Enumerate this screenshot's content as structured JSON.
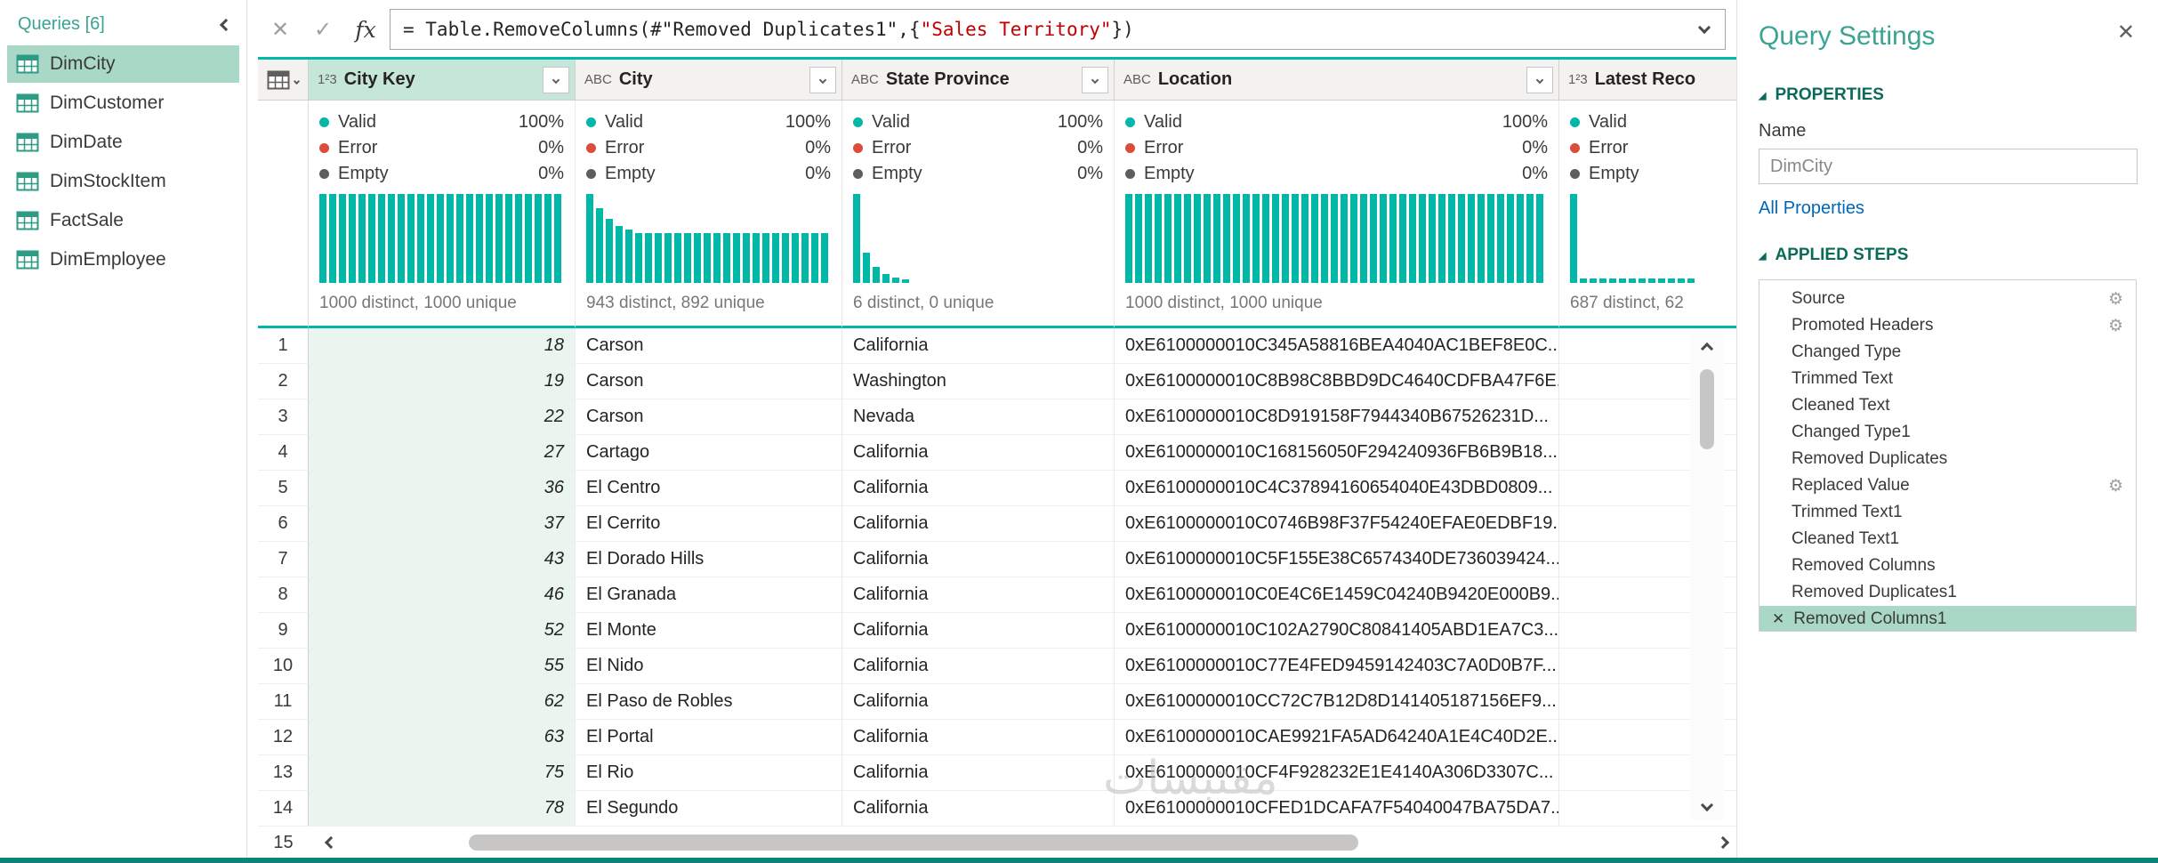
{
  "icons": {
    "cancel": "✕",
    "check": "✓",
    "fx": "fx",
    "close": "✕",
    "gear": "⚙",
    "delete_step": "✕",
    "section_triangle": "◢"
  },
  "colors": {
    "accent": "#00B7A8",
    "selection": "#A9D9C6",
    "header-selected": "#C5E6D8",
    "column-tint": "#EBF5F0",
    "error-dot": "#DD4B39",
    "empty-dot": "#605E5C",
    "formula-string": "#C00000",
    "link": "#0067B8",
    "section-heading": "#0B6A58",
    "pane-title": "#3AA394",
    "bottom-bar": "#0A8577"
  },
  "sidebar": {
    "title": "Queries [6]",
    "items": [
      {
        "label": "DimCity",
        "selected": true
      },
      {
        "label": "DimCustomer",
        "selected": false
      },
      {
        "label": "DimDate",
        "selected": false
      },
      {
        "label": "DimStockItem",
        "selected": false
      },
      {
        "label": "FactSale",
        "selected": false
      },
      {
        "label": "DimEmployee",
        "selected": false
      }
    ]
  },
  "formula_bar": {
    "prefix": "= Table.RemoveColumns(#\"Removed Duplicates1\",{",
    "string_arg": "\"Sales Territory\"",
    "suffix": "})"
  },
  "table": {
    "quality_labels": [
      "Valid",
      "Error",
      "Empty"
    ],
    "next_row_number": "15",
    "columns": [
      {
        "type": "1²3",
        "name": "City Key",
        "selected": true,
        "valid": "100%",
        "error": "0%",
        "empty": "0%",
        "distinct": "1000 distinct, 1000 unique",
        "bars": [
          1,
          1,
          1,
          1,
          1,
          1,
          1,
          1,
          1,
          1,
          1,
          1,
          1,
          1,
          1,
          1,
          1,
          1,
          1,
          1,
          1,
          1,
          1,
          1,
          1
        ]
      },
      {
        "type": "ABC",
        "name": "City",
        "selected": false,
        "valid": "100%",
        "error": "0%",
        "empty": "0%",
        "distinct": "943 distinct, 892 unique",
        "bars": [
          1,
          0.84,
          0.72,
          0.64,
          0.6,
          0.56,
          0.56,
          0.56,
          0.56,
          0.56,
          0.56,
          0.56,
          0.56,
          0.56,
          0.56,
          0.56,
          0.56,
          0.56,
          0.56,
          0.56,
          0.56,
          0.56,
          0.56,
          0.56,
          0.56
        ]
      },
      {
        "type": "ABC",
        "name": "State Province",
        "selected": false,
        "valid": "100%",
        "error": "0%",
        "empty": "0%",
        "distinct": "6 distinct, 0 unique",
        "bars": [
          1,
          0.34,
          0.18,
          0.1,
          0.06,
          0.04
        ]
      },
      {
        "type": "ABC",
        "name": "Location",
        "selected": false,
        "valid": "100%",
        "error": "0%",
        "empty": "0%",
        "distinct": "1000 distinct, 1000 unique",
        "bars": [
          1,
          1,
          1,
          1,
          1,
          1,
          1,
          1,
          1,
          1,
          1,
          1,
          1,
          1,
          1,
          1,
          1,
          1,
          1,
          1,
          1,
          1,
          1,
          1,
          1,
          1,
          1,
          1,
          1,
          1,
          1,
          1,
          1,
          1,
          1,
          1,
          1,
          1,
          1,
          1,
          1,
          1,
          1
        ]
      },
      {
        "type": "1²3",
        "name": "Latest Reco",
        "selected": false,
        "valid": "",
        "error": "",
        "empty": "",
        "distinct": "687 distinct, 62",
        "bars": [
          1,
          0.05,
          0.05,
          0.05,
          0.05,
          0.05,
          0.05,
          0.05,
          0.05,
          0.05,
          0.05,
          0.05,
          0.05
        ]
      }
    ],
    "rows": [
      {
        "n": "1",
        "cells": [
          "18",
          "Carson",
          "California",
          "0xE6100000010C345A58816BEA4040AC1BEF8E0C...",
          ""
        ]
      },
      {
        "n": "2",
        "cells": [
          "19",
          "Carson",
          "Washington",
          "0xE6100000010C8B98C8BBD9DC4640CDFBA47F6E...",
          ""
        ]
      },
      {
        "n": "3",
        "cells": [
          "22",
          "Carson",
          "Nevada",
          "0xE6100000010C8D919158F7944340B67526231D...",
          ""
        ]
      },
      {
        "n": "4",
        "cells": [
          "27",
          "Cartago",
          "California",
          "0xE6100000010C168156050F294240936FB6B9B18...",
          ""
        ]
      },
      {
        "n": "5",
        "cells": [
          "36",
          "El Centro",
          "California",
          "0xE6100000010C4C37894160654040E43DBD0809...",
          ""
        ]
      },
      {
        "n": "6",
        "cells": [
          "37",
          "El Cerrito",
          "California",
          "0xE6100000010C0746B98F37F54240EFAE0EDBF19...",
          ""
        ]
      },
      {
        "n": "7",
        "cells": [
          "43",
          "El Dorado Hills",
          "California",
          "0xE6100000010C5F155E38C6574340DE736039424...",
          ""
        ]
      },
      {
        "n": "8",
        "cells": [
          "46",
          "El Granada",
          "California",
          "0xE6100000010C0E4C6E1459C04240B9420E000B9...",
          ""
        ]
      },
      {
        "n": "9",
        "cells": [
          "52",
          "El Monte",
          "California",
          "0xE6100000010C102A2790C80841405ABD1EA7C3...",
          ""
        ]
      },
      {
        "n": "10",
        "cells": [
          "55",
          "El Nido",
          "California",
          "0xE6100000010C77E4FED9459142403C7A0D0B7F...",
          ""
        ]
      },
      {
        "n": "11",
        "cells": [
          "62",
          "El Paso de Robles",
          "California",
          "0xE6100000010CC72C7B12D8D141405187156EF9...",
          ""
        ]
      },
      {
        "n": "12",
        "cells": [
          "63",
          "El Portal",
          "California",
          "0xE6100000010CAE9921FA5AD64240A1E4C40D2E...",
          ""
        ]
      },
      {
        "n": "13",
        "cells": [
          "75",
          "El Rio",
          "California",
          "0xE6100000010CF4F928232E1E4140A306D3307C...",
          ""
        ]
      },
      {
        "n": "14",
        "cells": [
          "78",
          "El Segundo",
          "California",
          "0xE6100000010CFED1DCAFA7F54040047BA75DA7...",
          ""
        ]
      }
    ]
  },
  "query_settings": {
    "title": "Query Settings",
    "properties_heading": "PROPERTIES",
    "name_label": "Name",
    "name_value": "DimCity",
    "all_properties_label": "All Properties",
    "applied_steps_heading": "APPLIED STEPS",
    "steps": [
      {
        "label": "Source",
        "gear": true,
        "selected": false
      },
      {
        "label": "Promoted Headers",
        "gear": true,
        "selected": false
      },
      {
        "label": "Changed Type",
        "gear": false,
        "selected": false
      },
      {
        "label": "Trimmed Text",
        "gear": false,
        "selected": false
      },
      {
        "label": "Cleaned Text",
        "gear": false,
        "selected": false
      },
      {
        "label": "Changed Type1",
        "gear": false,
        "selected": false
      },
      {
        "label": "Removed Duplicates",
        "gear": false,
        "selected": false
      },
      {
        "label": "Replaced Value",
        "gear": true,
        "selected": false
      },
      {
        "label": "Trimmed Text1",
        "gear": false,
        "selected": false
      },
      {
        "label": "Cleaned Text1",
        "gear": false,
        "selected": false
      },
      {
        "label": "Removed Columns",
        "gear": false,
        "selected": false
      },
      {
        "label": "Removed Duplicates1",
        "gear": false,
        "selected": false
      },
      {
        "label": "Removed Columns1",
        "gear": false,
        "selected": true
      }
    ]
  },
  "watermark": "مقتبسات"
}
